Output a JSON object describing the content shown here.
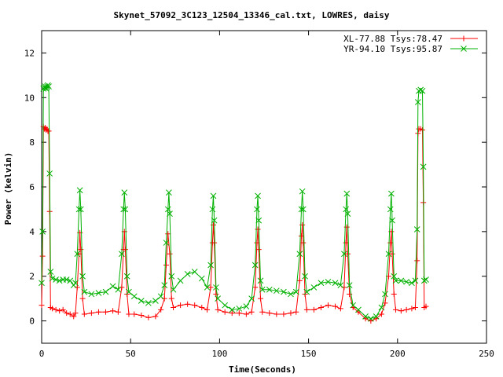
{
  "chart_data": {
    "type": "line",
    "title": "Skynet_57092_3C123_12504_13346_cal.txt, LOWRES, daisy",
    "xlabel": "Time(Seconds)",
    "ylabel": "Power (kelvin)",
    "xlim": [
      0,
      250
    ],
    "ylim": [
      -1,
      13
    ],
    "xticks": [
      0,
      50,
      100,
      150,
      200,
      250
    ],
    "yticks": [
      0,
      2,
      4,
      6,
      8,
      10,
      12
    ],
    "grid": false,
    "legend_position": "top-right",
    "series": [
      {
        "name": "XL-77.88 Tsys:78.47",
        "color": "#ff0000",
        "marker": "plus",
        "points": [
          [
            0.0,
            0.7
          ],
          [
            0.5,
            2.9
          ],
          [
            1.0,
            8.7
          ],
          [
            1.5,
            8.6
          ],
          [
            2.0,
            8.65
          ],
          [
            2.5,
            8.55
          ],
          [
            3.0,
            8.6
          ],
          [
            3.5,
            8.5
          ],
          [
            4.0,
            8.5
          ],
          [
            4.5,
            4.9
          ],
          [
            5.0,
            0.6
          ],
          [
            6.0,
            0.55
          ],
          [
            8.0,
            0.5
          ],
          [
            10.0,
            0.45
          ],
          [
            12.0,
            0.5
          ],
          [
            14.0,
            0.35
          ],
          [
            16.0,
            0.3
          ],
          [
            18.0,
            0.2
          ],
          [
            19.0,
            0.35
          ],
          [
            20.0,
            1.5
          ],
          [
            21.0,
            3.0
          ],
          [
            21.5,
            3.95
          ],
          [
            22.0,
            3.2
          ],
          [
            23.0,
            1.0
          ],
          [
            24.0,
            0.3
          ],
          [
            28.0,
            0.35
          ],
          [
            32.0,
            0.4
          ],
          [
            36.0,
            0.4
          ],
          [
            40.0,
            0.45
          ],
          [
            43.0,
            0.4
          ],
          [
            45.0,
            1.5
          ],
          [
            46.0,
            3.2
          ],
          [
            46.5,
            4.0
          ],
          [
            47.0,
            3.2
          ],
          [
            48.0,
            1.2
          ],
          [
            49.0,
            0.3
          ],
          [
            52.0,
            0.3
          ],
          [
            56.0,
            0.25
          ],
          [
            60.0,
            0.15
          ],
          [
            64.0,
            0.2
          ],
          [
            67.0,
            0.5
          ],
          [
            69.0,
            1.0
          ],
          [
            70.0,
            2.5
          ],
          [
            71.0,
            3.9
          ],
          [
            72.0,
            3.0
          ],
          [
            73.0,
            1.0
          ],
          [
            74.0,
            0.6
          ],
          [
            78.0,
            0.7
          ],
          [
            82.0,
            0.75
          ],
          [
            86.0,
            0.7
          ],
          [
            90.0,
            0.6
          ],
          [
            93.0,
            0.5
          ],
          [
            95.0,
            1.5
          ],
          [
            96.0,
            3.5
          ],
          [
            96.5,
            4.3
          ],
          [
            97.0,
            3.5
          ],
          [
            98.0,
            1.2
          ],
          [
            99.0,
            0.5
          ],
          [
            103.0,
            0.4
          ],
          [
            107.0,
            0.35
          ],
          [
            111.0,
            0.35
          ],
          [
            115.0,
            0.3
          ],
          [
            118.0,
            0.4
          ],
          [
            120.0,
            1.5
          ],
          [
            121.0,
            3.5
          ],
          [
            121.5,
            4.1
          ],
          [
            122.0,
            3.2
          ],
          [
            123.0,
            1.0
          ],
          [
            124.0,
            0.4
          ],
          [
            128.0,
            0.35
          ],
          [
            132.0,
            0.3
          ],
          [
            136.0,
            0.3
          ],
          [
            140.0,
            0.35
          ],
          [
            143.0,
            0.4
          ],
          [
            145.0,
            1.8
          ],
          [
            146.0,
            3.8
          ],
          [
            146.5,
            4.3
          ],
          [
            147.0,
            3.5
          ],
          [
            148.0,
            1.2
          ],
          [
            149.0,
            0.5
          ],
          [
            153.0,
            0.5
          ],
          [
            157.0,
            0.6
          ],
          [
            161.0,
            0.7
          ],
          [
            165.0,
            0.65
          ],
          [
            168.0,
            0.55
          ],
          [
            170.0,
            1.5
          ],
          [
            171.0,
            3.5
          ],
          [
            171.5,
            4.2
          ],
          [
            172.0,
            3.0
          ],
          [
            173.0,
            1.2
          ],
          [
            175.0,
            0.6
          ],
          [
            178.0,
            0.4
          ],
          [
            182.0,
            0.1
          ],
          [
            185.0,
            0.0
          ],
          [
            188.0,
            0.1
          ],
          [
            191.0,
            0.3
          ],
          [
            193.0,
            0.8
          ],
          [
            195.0,
            2.0
          ],
          [
            196.0,
            3.5
          ],
          [
            196.5,
            4.0
          ],
          [
            197.0,
            3.0
          ],
          [
            198.0,
            1.2
          ],
          [
            199.0,
            0.5
          ],
          [
            202.0,
            0.45
          ],
          [
            205.0,
            0.5
          ],
          [
            208.0,
            0.55
          ],
          [
            210.0,
            0.6
          ],
          [
            211.0,
            2.7
          ],
          [
            211.5,
            8.4
          ],
          [
            212.0,
            8.6
          ],
          [
            213.0,
            8.6
          ],
          [
            214.0,
            8.55
          ],
          [
            214.5,
            5.3
          ],
          [
            215.0,
            0.6
          ],
          [
            216.0,
            0.65
          ]
        ]
      },
      {
        "name": "YR-94.10 Tsys:95.87",
        "color": "#00b000",
        "marker": "cross",
        "points": [
          [
            0.0,
            1.7
          ],
          [
            0.5,
            4.0
          ],
          [
            1.0,
            10.4
          ],
          [
            1.5,
            10.45
          ],
          [
            2.0,
            10.5
          ],
          [
            2.5,
            10.4
          ],
          [
            3.0,
            10.5
          ],
          [
            3.5,
            10.55
          ],
          [
            4.0,
            10.5
          ],
          [
            4.5,
            6.6
          ],
          [
            5.0,
            2.2
          ],
          [
            6.0,
            1.9
          ],
          [
            8.0,
            1.85
          ],
          [
            10.0,
            1.8
          ],
          [
            12.0,
            1.85
          ],
          [
            14.0,
            1.85
          ],
          [
            16.0,
            1.8
          ],
          [
            18.0,
            1.6
          ],
          [
            19.0,
            1.7
          ],
          [
            20.0,
            3.0
          ],
          [
            21.0,
            5.0
          ],
          [
            21.5,
            5.85
          ],
          [
            22.0,
            5.0
          ],
          [
            23.0,
            2.0
          ],
          [
            24.0,
            1.3
          ],
          [
            28.0,
            1.2
          ],
          [
            32.0,
            1.25
          ],
          [
            36.0,
            1.3
          ],
          [
            40.0,
            1.55
          ],
          [
            43.0,
            1.4
          ],
          [
            45.0,
            3.0
          ],
          [
            46.0,
            5.0
          ],
          [
            46.5,
            5.75
          ],
          [
            47.0,
            5.0
          ],
          [
            48.0,
            2.0
          ],
          [
            49.0,
            1.3
          ],
          [
            52.0,
            1.1
          ],
          [
            56.0,
            0.9
          ],
          [
            60.0,
            0.8
          ],
          [
            64.0,
            0.9
          ],
          [
            67.0,
            1.1
          ],
          [
            69.0,
            1.6
          ],
          [
            70.0,
            3.5
          ],
          [
            71.0,
            5.0
          ],
          [
            71.5,
            5.75
          ],
          [
            72.0,
            4.8
          ],
          [
            73.0,
            2.0
          ],
          [
            74.0,
            1.4
          ],
          [
            78.0,
            1.8
          ],
          [
            82.0,
            2.1
          ],
          [
            86.0,
            2.2
          ],
          [
            90.0,
            1.9
          ],
          [
            93.0,
            1.5
          ],
          [
            95.0,
            2.5
          ],
          [
            96.0,
            5.0
          ],
          [
            96.5,
            5.6
          ],
          [
            97.0,
            4.5
          ],
          [
            98.0,
            1.5
          ],
          [
            99.0,
            1.0
          ],
          [
            103.0,
            0.7
          ],
          [
            107.0,
            0.5
          ],
          [
            111.0,
            0.55
          ],
          [
            115.0,
            0.65
          ],
          [
            118.0,
            1.0
          ],
          [
            120.0,
            2.5
          ],
          [
            121.0,
            5.0
          ],
          [
            121.5,
            5.6
          ],
          [
            122.0,
            4.5
          ],
          [
            123.0,
            1.8
          ],
          [
            124.0,
            1.4
          ],
          [
            128.0,
            1.4
          ],
          [
            132.0,
            1.35
          ],
          [
            136.0,
            1.3
          ],
          [
            140.0,
            1.2
          ],
          [
            143.0,
            1.3
          ],
          [
            145.0,
            3.0
          ],
          [
            146.0,
            5.0
          ],
          [
            146.5,
            5.8
          ],
          [
            147.0,
            5.0
          ],
          [
            148.0,
            2.0
          ],
          [
            149.0,
            1.3
          ],
          [
            153.0,
            1.5
          ],
          [
            157.0,
            1.7
          ],
          [
            161.0,
            1.75
          ],
          [
            165.0,
            1.7
          ],
          [
            168.0,
            1.6
          ],
          [
            170.0,
            3.0
          ],
          [
            171.0,
            5.0
          ],
          [
            171.5,
            5.7
          ],
          [
            172.0,
            4.8
          ],
          [
            173.0,
            1.6
          ],
          [
            175.0,
            0.7
          ],
          [
            178.0,
            0.5
          ],
          [
            182.0,
            0.2
          ],
          [
            185.0,
            0.1
          ],
          [
            188.0,
            0.2
          ],
          [
            191.0,
            0.6
          ],
          [
            193.0,
            1.2
          ],
          [
            195.0,
            3.0
          ],
          [
            196.0,
            5.0
          ],
          [
            196.5,
            5.7
          ],
          [
            197.0,
            4.5
          ],
          [
            198.0,
            2.0
          ],
          [
            199.0,
            1.8
          ],
          [
            202.0,
            1.8
          ],
          [
            205.0,
            1.75
          ],
          [
            208.0,
            1.7
          ],
          [
            210.0,
            1.8
          ],
          [
            211.0,
            4.1
          ],
          [
            211.5,
            9.8
          ],
          [
            212.0,
            10.3
          ],
          [
            213.0,
            10.35
          ],
          [
            214.0,
            10.3
          ],
          [
            214.5,
            6.9
          ],
          [
            215.0,
            1.8
          ],
          [
            216.0,
            1.85
          ]
        ]
      }
    ]
  }
}
